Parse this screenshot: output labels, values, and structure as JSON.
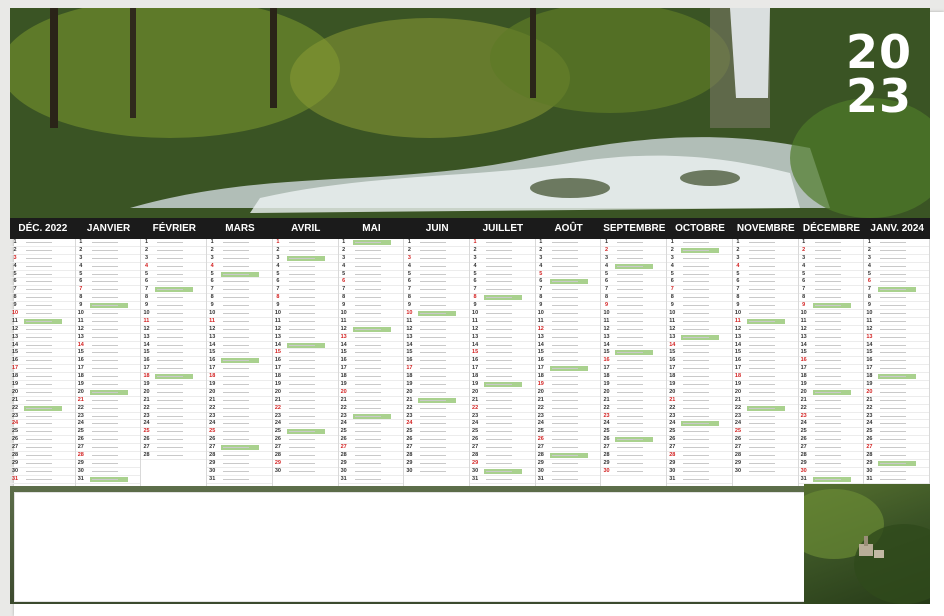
{
  "calendar": {
    "year_top": "20",
    "year_bottom": "23",
    "photo_caption": "",
    "months": [
      "DÉC. 2022",
      "JANVIER",
      "FÉVRIER",
      "MARS",
      "AVRIL",
      "MAI",
      "JUIN",
      "JUILLET",
      "AOÛT",
      "SEPTEMBRE",
      "OCTOBRE",
      "NOVEMBRE",
      "DÉCEMBRE",
      "JANV. 2024"
    ],
    "footer_caption": ""
  },
  "colors": {
    "header_bar": "#1b1b1b",
    "sunday_red": "#d21f1f",
    "holiday_green": "#a9d18e"
  }
}
